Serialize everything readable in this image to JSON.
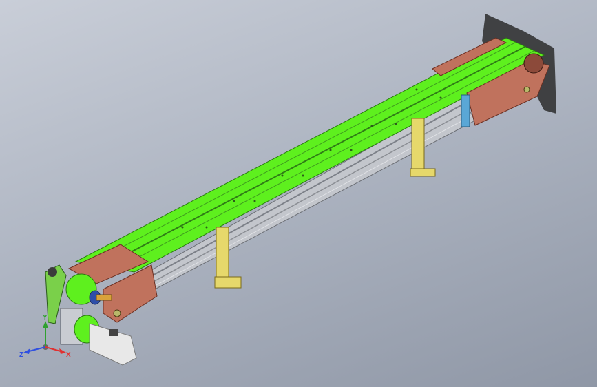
{
  "viewport": {
    "background_top": "#c9ced8",
    "background_bottom": "#8f97a6"
  },
  "model": {
    "belt_color": "#5ef01e",
    "frame_color": "#b9bcc2",
    "end_plate_color": "#c0725d",
    "bracket_color": "#e6d86b",
    "motor_color": "#e8e8e8",
    "tensioner_color": "#5aa7d6"
  },
  "triad": {
    "x_label": "X",
    "y_label": "Y",
    "z_label": "Z",
    "x_color": "#e03030",
    "y_color": "#30a030",
    "z_color": "#3050e0"
  }
}
